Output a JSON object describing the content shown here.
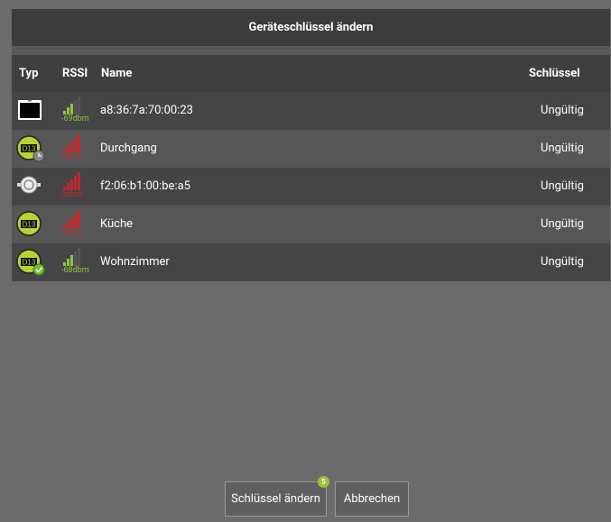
{
  "dialog": {
    "title": "Geräteschlüssel ändern"
  },
  "table": {
    "columns": {
      "typ": "Typ",
      "rssi": "RSSI",
      "name": "Name",
      "key": "Schlüssel"
    },
    "rows": [
      {
        "type_icon": "tablet-icon",
        "rssi": "-69dbm",
        "rssi_status": "good",
        "name": "a8:36:7a:70:00:23",
        "key": "Ungültig"
      },
      {
        "type_icon": "d13-controller-clock-icon",
        "rssi": "0dbm",
        "rssi_status": "bad",
        "name": "Durchgang",
        "key": "Ungültig"
      },
      {
        "type_icon": "sensor-icon",
        "rssi": "0dbm",
        "rssi_status": "bad",
        "name": "f2:06:b1:00:be:a5",
        "key": "Ungültig"
      },
      {
        "type_icon": "d13-controller-icon",
        "rssi": "0dbm",
        "rssi_status": "bad",
        "name": "Küche",
        "key": "Ungültig"
      },
      {
        "type_icon": "d13-controller-check-icon",
        "rssi": "-68dbm",
        "rssi_status": "good",
        "name": "Wohnzimmer",
        "key": "Ungültig"
      }
    ]
  },
  "buttons": {
    "change_key": "Schlüssel ändern",
    "change_key_badge": "5",
    "cancel": "Abbrechen"
  },
  "colors": {
    "rssi_good": "#8cc63f",
    "rssi_bad": "#c0282d",
    "badge": "#9bc13a"
  }
}
